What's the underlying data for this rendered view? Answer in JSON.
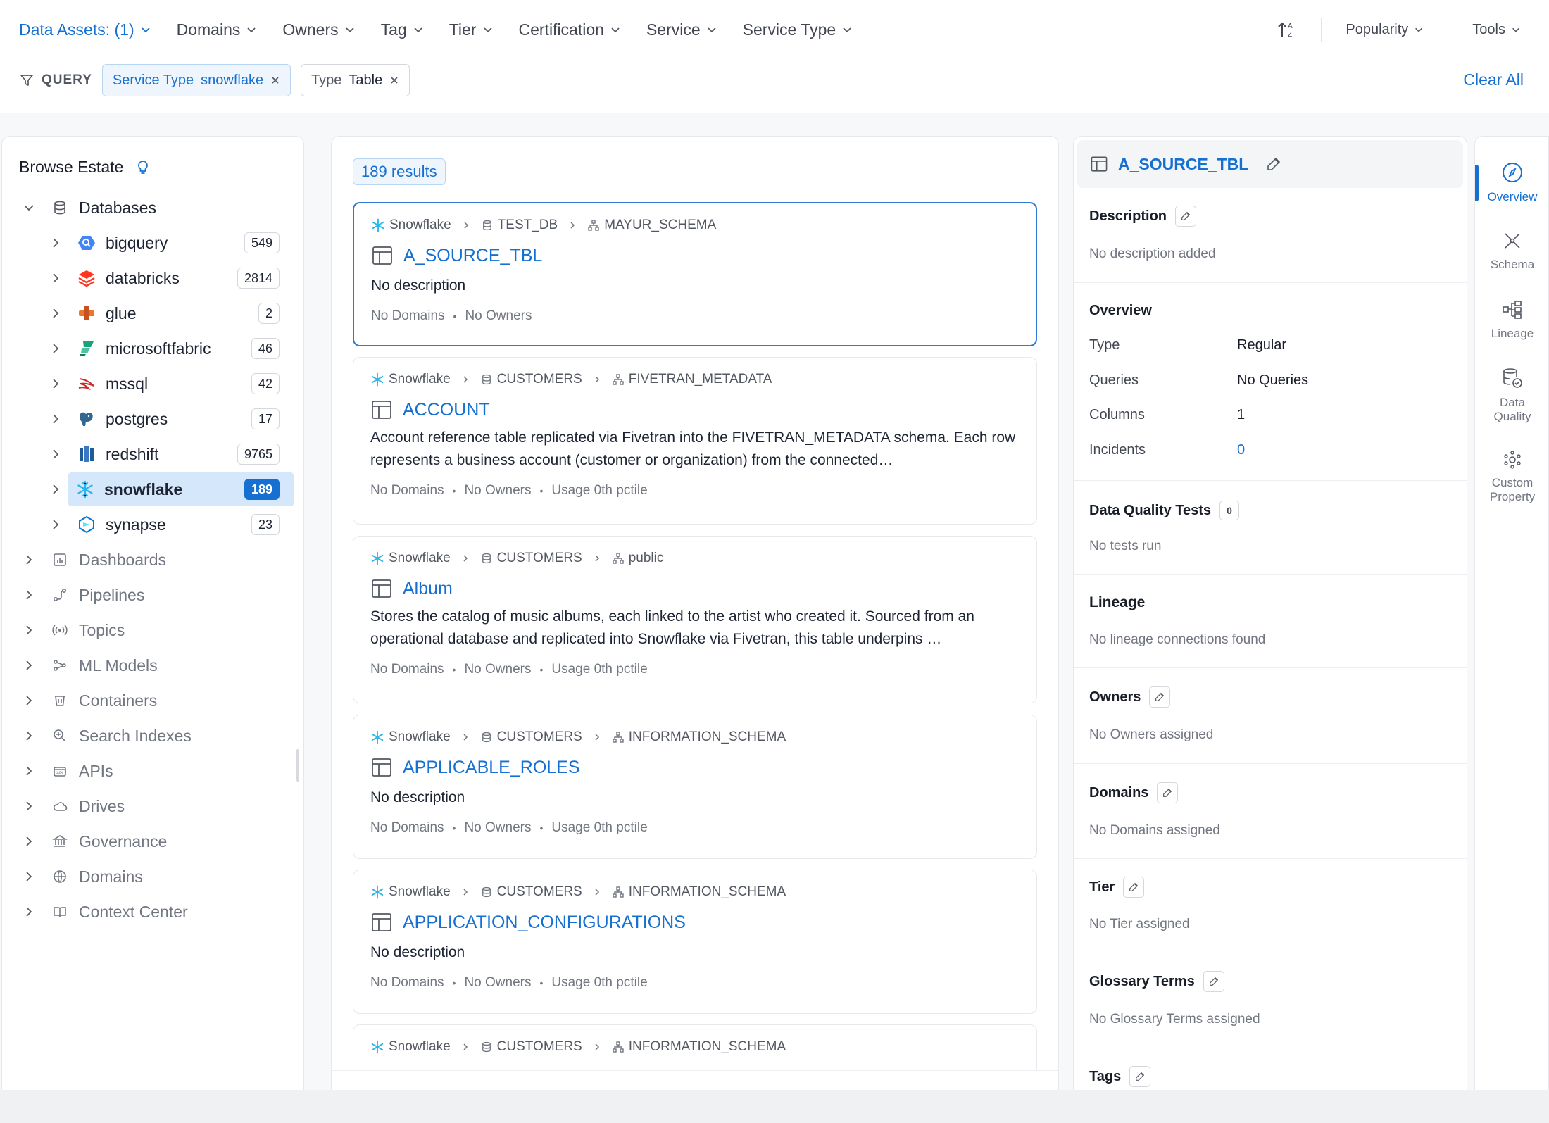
{
  "filters": {
    "data_assets": "Data Assets: (1)",
    "domains": "Domains",
    "owners": "Owners",
    "tag": "Tag",
    "tier": "Tier",
    "certification": "Certification",
    "service": "Service",
    "service_type": "Service Type"
  },
  "sort": {
    "label": "Popularity"
  },
  "tools": {
    "label": "Tools"
  },
  "query": {
    "label": "QUERY",
    "chips": [
      {
        "key": "Service Type",
        "value": "snowflake"
      },
      {
        "key": "Type",
        "value": "Table"
      }
    ],
    "clear_all": "Clear All"
  },
  "browse": {
    "title": "Browse Estate",
    "databases_label": "Databases",
    "services": [
      {
        "name": "bigquery",
        "count": "549"
      },
      {
        "name": "databricks",
        "count": "2814"
      },
      {
        "name": "glue",
        "count": "2"
      },
      {
        "name": "microsoftfabric",
        "count": "46"
      },
      {
        "name": "mssql",
        "count": "42"
      },
      {
        "name": "postgres",
        "count": "17"
      },
      {
        "name": "redshift",
        "count": "9765"
      },
      {
        "name": "snowflake",
        "count": "189"
      },
      {
        "name": "synapse",
        "count": "23"
      }
    ],
    "categories": [
      "Dashboards",
      "Pipelines",
      "Topics",
      "ML Models",
      "Containers",
      "Search Indexes",
      "APIs",
      "Drives",
      "Governance",
      "Domains",
      "Context Center"
    ]
  },
  "results": {
    "count_label": "189 results",
    "items": [
      {
        "service": "Snowflake",
        "database": "TEST_DB",
        "schema": "MAYUR_SCHEMA",
        "title": "A_SOURCE_TBL",
        "description": "No description",
        "domains": "No Domains",
        "owners": "No Owners",
        "usage": ""
      },
      {
        "service": "Snowflake",
        "database": "CUSTOMERS",
        "schema": "FIVETRAN_METADATA",
        "title": "ACCOUNT",
        "description": "Account reference table replicated via Fivetran into the FIVETRAN_METADATA schema. Each row represents a business account (customer or organization) from the connected…",
        "domains": "No Domains",
        "owners": "No Owners",
        "usage": "Usage 0th pctile"
      },
      {
        "service": "Snowflake",
        "database": "CUSTOMERS",
        "schema": "public",
        "title": "Album",
        "description": "Stores the catalog of music albums, each linked to the artist who created it. Sourced from an operational database and replicated into Snowflake via Fivetran, this table underpins …",
        "domains": "No Domains",
        "owners": "No Owners",
        "usage": "Usage 0th pctile"
      },
      {
        "service": "Snowflake",
        "database": "CUSTOMERS",
        "schema": "INFORMATION_SCHEMA",
        "title": "APPLICABLE_ROLES",
        "description": "No description",
        "domains": "No Domains",
        "owners": "No Owners",
        "usage": "Usage 0th pctile"
      },
      {
        "service": "Snowflake",
        "database": "CUSTOMERS",
        "schema": "INFORMATION_SCHEMA",
        "title": "APPLICATION_CONFIGURATIONS",
        "description": "No description",
        "domains": "No Domains",
        "owners": "No Owners",
        "usage": "Usage 0th pctile"
      },
      {
        "service": "Snowflake",
        "database": "CUSTOMERS",
        "schema": "INFORMATION_SCHEMA",
        "title": "",
        "description": "",
        "domains": "",
        "owners": "",
        "usage": ""
      }
    ]
  },
  "details": {
    "title": "A_SOURCE_TBL",
    "description_label": "Description",
    "description_text": "No description added",
    "overview_label": "Overview",
    "overview": [
      {
        "key": "Type",
        "value": "Regular"
      },
      {
        "key": "Queries",
        "value": "No Queries"
      },
      {
        "key": "Columns",
        "value": "1"
      },
      {
        "key": "Incidents",
        "value": "0"
      }
    ],
    "dq_label": "Data Quality Tests",
    "dq_count": "0",
    "dq_text": "No tests run",
    "lineage_label": "Lineage",
    "lineage_text": "No lineage connections found",
    "owners_label": "Owners",
    "owners_text": "No Owners assigned",
    "domains_label": "Domains",
    "domains_text": "No Domains assigned",
    "tier_label": "Tier",
    "tier_text": "No Tier assigned",
    "glossary_label": "Glossary Terms",
    "glossary_text": "No Glossary Terms assigned",
    "tags_label": "Tags"
  },
  "side_tabs": [
    "Overview",
    "Schema",
    "Lineage",
    "Data Quality",
    "Custom Property"
  ],
  "colors": {
    "accent": "#1570d2",
    "selected_bg": "#d5e7fb",
    "snowflake": "#29b5e8"
  }
}
